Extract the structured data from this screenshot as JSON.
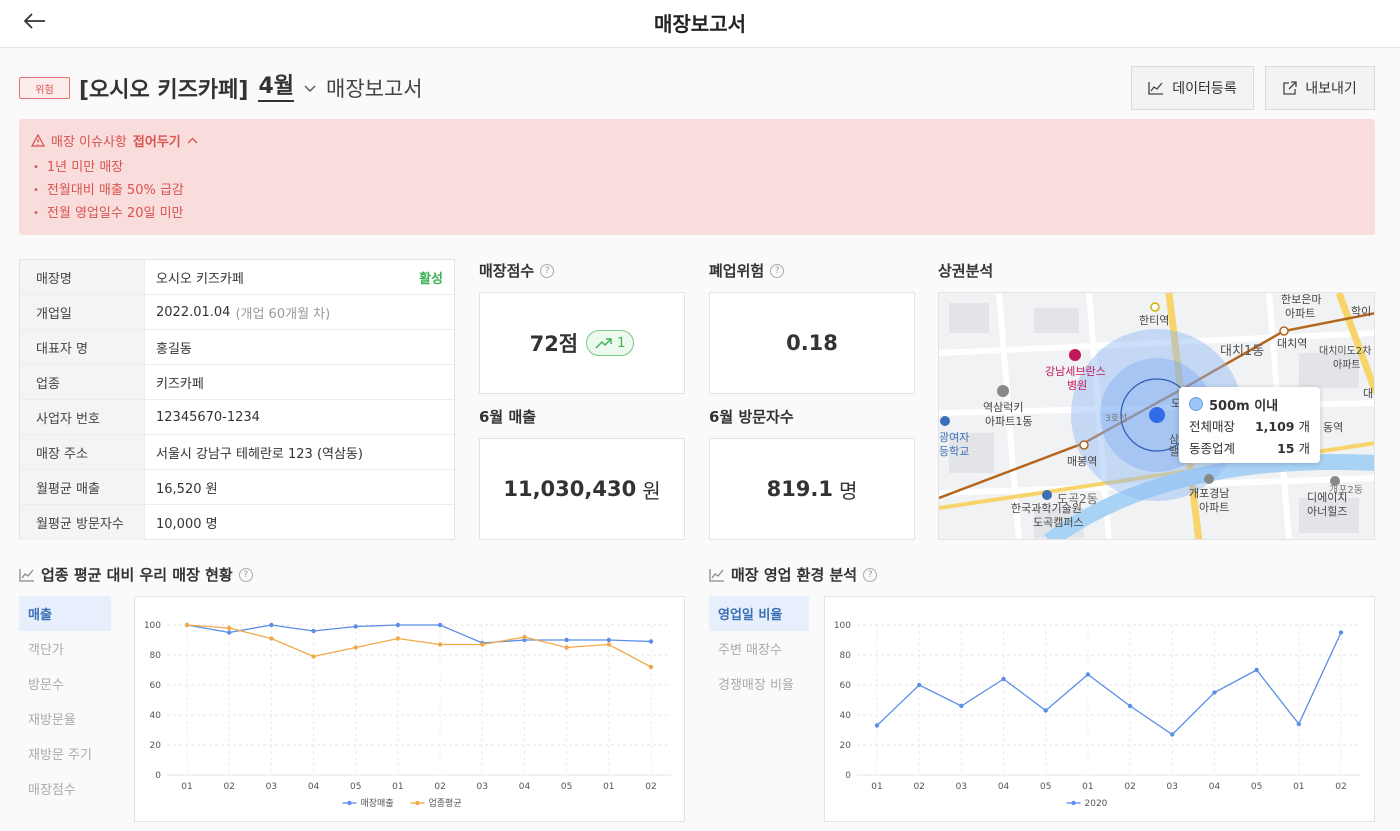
{
  "header": {
    "title": "매장보고서"
  },
  "title_row": {
    "badge": "위험",
    "store_name": "[오시오 키즈카페]",
    "month": "4월",
    "report_label": "매장보고서",
    "buttons": {
      "data_register": "데이터등록",
      "export": "내보내기"
    }
  },
  "alert": {
    "title": "매장 이슈사항",
    "toggle": "접어두기",
    "items": [
      "1년 미만 매장",
      "전월대비 매출 50% 급감",
      "전월 영업일수 20일 미만"
    ]
  },
  "store_info": {
    "rows": [
      {
        "label": "매장명",
        "value": "오시오 키즈카페",
        "tag": "활성"
      },
      {
        "label": "개업일",
        "value": "2022.01.04",
        "sub": "(개업 60개월 차)"
      },
      {
        "label": "대표자 명",
        "value": "홍길동"
      },
      {
        "label": "업종",
        "value": "키즈카페"
      },
      {
        "label": "사업자 번호",
        "value": "12345670-1234"
      },
      {
        "label": "매장 주소",
        "value": "서울시 강남구 테헤란로 123 (역삼동)"
      },
      {
        "label": "월평균 매출",
        "value": "16,520 원"
      },
      {
        "label": "월평균 방문자수",
        "value": "10,000 명"
      }
    ]
  },
  "metrics": {
    "score": {
      "title": "매장점수",
      "value": "72점",
      "trend": "1"
    },
    "closure_risk": {
      "title": "폐업위험",
      "value": "0.18"
    },
    "sales": {
      "title": "6월 매출",
      "value": "11,030,430",
      "unit": "원"
    },
    "visitors": {
      "title": "6월 방문자수",
      "value": "819.1",
      "unit": "명"
    }
  },
  "trade_area": {
    "title": "상권분석",
    "labels": [
      "한보은마",
      "아파트",
      "학이",
      "한티역",
      "대치1동",
      "대치역",
      "대치미도2차",
      "아파트",
      "강남세브란스",
      "병원",
      "역삼럭키",
      "아파트1동",
      "광여자",
      "등학교",
      "매봉역",
      "삼성",
      "팰리",
      "개포경남",
      "아파트",
      "도곡2동",
      "한국과학기술원",
      "도곡캠퍼스",
      "디에이치",
      "아너힐즈",
      "동역",
      "대",
      "도",
      "개포2동",
      "3호선"
    ],
    "tooltip": {
      "title": "500m 이내",
      "total_label": "전체매장",
      "total_value": "1,109",
      "same_label": "동종업계",
      "same_value": "15",
      "unit": "개"
    },
    "colors": {
      "radius": "#8fb8f5",
      "road": "#f7d56b",
      "water": "#a9d3f5",
      "subway": "#b5651d"
    }
  },
  "comparison": {
    "title": "업종 평균 대비 우리 매장 현황",
    "tabs": [
      "매출",
      "객단가",
      "방문수",
      "재방문율",
      "재방문 주기",
      "매장점수"
    ],
    "active_tab": 0
  },
  "environment": {
    "title": "매장 영업 환경 분석",
    "tabs": [
      "영업일 비율",
      "주변 매장수",
      "경쟁매장 비율"
    ],
    "active_tab": 0
  },
  "chart_data": [
    {
      "type": "line",
      "x": [
        "01",
        "02",
        "03",
        "04",
        "05",
        "01",
        "02",
        "03",
        "04",
        "05",
        "01",
        "02"
      ],
      "ylim": [
        0,
        100
      ],
      "yticks": [
        0,
        20,
        40,
        60,
        80,
        100
      ],
      "grid": true,
      "legend": "bottom",
      "series": [
        {
          "name": "매장매출",
          "color": "#5b8ee6",
          "values": [
            100,
            95,
            100,
            96,
            99,
            100,
            100,
            88,
            90,
            90,
            90,
            89
          ]
        },
        {
          "name": "업종평균",
          "color": "#f2a94a",
          "values": [
            100,
            98,
            91,
            79,
            85,
            91,
            87,
            87,
            92,
            85,
            87,
            72
          ]
        }
      ]
    },
    {
      "type": "line",
      "x": [
        "01",
        "02",
        "03",
        "04",
        "05",
        "01",
        "02",
        "03",
        "04",
        "05",
        "01",
        "02"
      ],
      "ylim": [
        0,
        100
      ],
      "yticks": [
        0,
        20,
        40,
        60,
        80,
        100
      ],
      "grid": true,
      "legend": "bottom",
      "series": [
        {
          "name": "2020",
          "color": "#5b8ee6",
          "values": [
            33,
            60,
            46,
            64,
            43,
            67,
            46,
            27,
            55,
            70,
            34,
            95
          ]
        }
      ]
    }
  ]
}
